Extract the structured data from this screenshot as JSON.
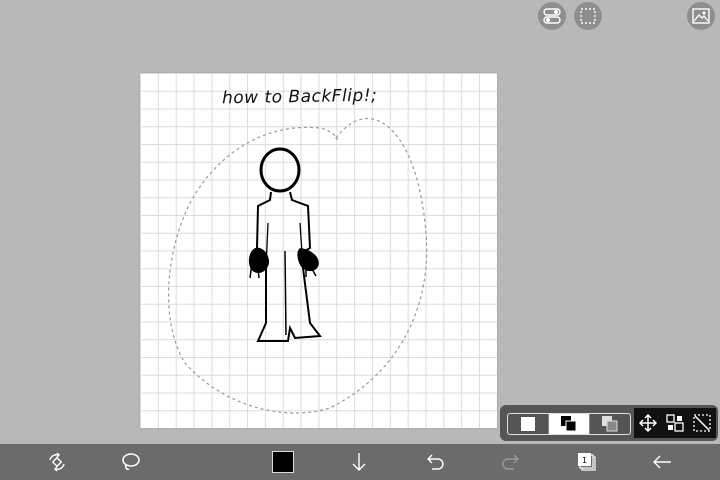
{
  "canvas": {
    "handwritten_note": "how to BackFlip!;",
    "grid": true,
    "paper_color": "#ffffff",
    "ink_color": "#000000"
  },
  "top_right_buttons": {
    "items": [
      {
        "icon": "toggle-settings-icon"
      },
      {
        "icon": "selection-frame-icon"
      },
      {
        "icon": "image-icon"
      }
    ]
  },
  "selection_panel": {
    "modes": [
      {
        "icon": "select-new-icon",
        "selected": false
      },
      {
        "icon": "select-add-icon",
        "selected": true
      },
      {
        "icon": "select-subtract-icon",
        "selected": false
      }
    ],
    "tools": [
      {
        "icon": "move-icon"
      },
      {
        "icon": "transform-icon"
      },
      {
        "icon": "deselect-icon"
      }
    ]
  },
  "bottom_toolbar": {
    "items": [
      {
        "icon": "eraser-transform-icon",
        "enabled": true
      },
      {
        "icon": "lasso-icon",
        "enabled": true
      },
      {
        "icon": "color-swatch",
        "enabled": true,
        "color": "#000000"
      },
      {
        "icon": "save-down-arrow-icon",
        "enabled": true
      },
      {
        "icon": "undo-icon",
        "enabled": true
      },
      {
        "icon": "redo-icon",
        "enabled": false
      },
      {
        "icon": "layers-icon",
        "enabled": true
      },
      {
        "icon": "back-arrow-icon",
        "enabled": true
      }
    ],
    "layer_count": "1"
  },
  "colors": {
    "background": "#b8b8b8",
    "toolbar": "#6b6b6b",
    "panel": "#555555"
  }
}
